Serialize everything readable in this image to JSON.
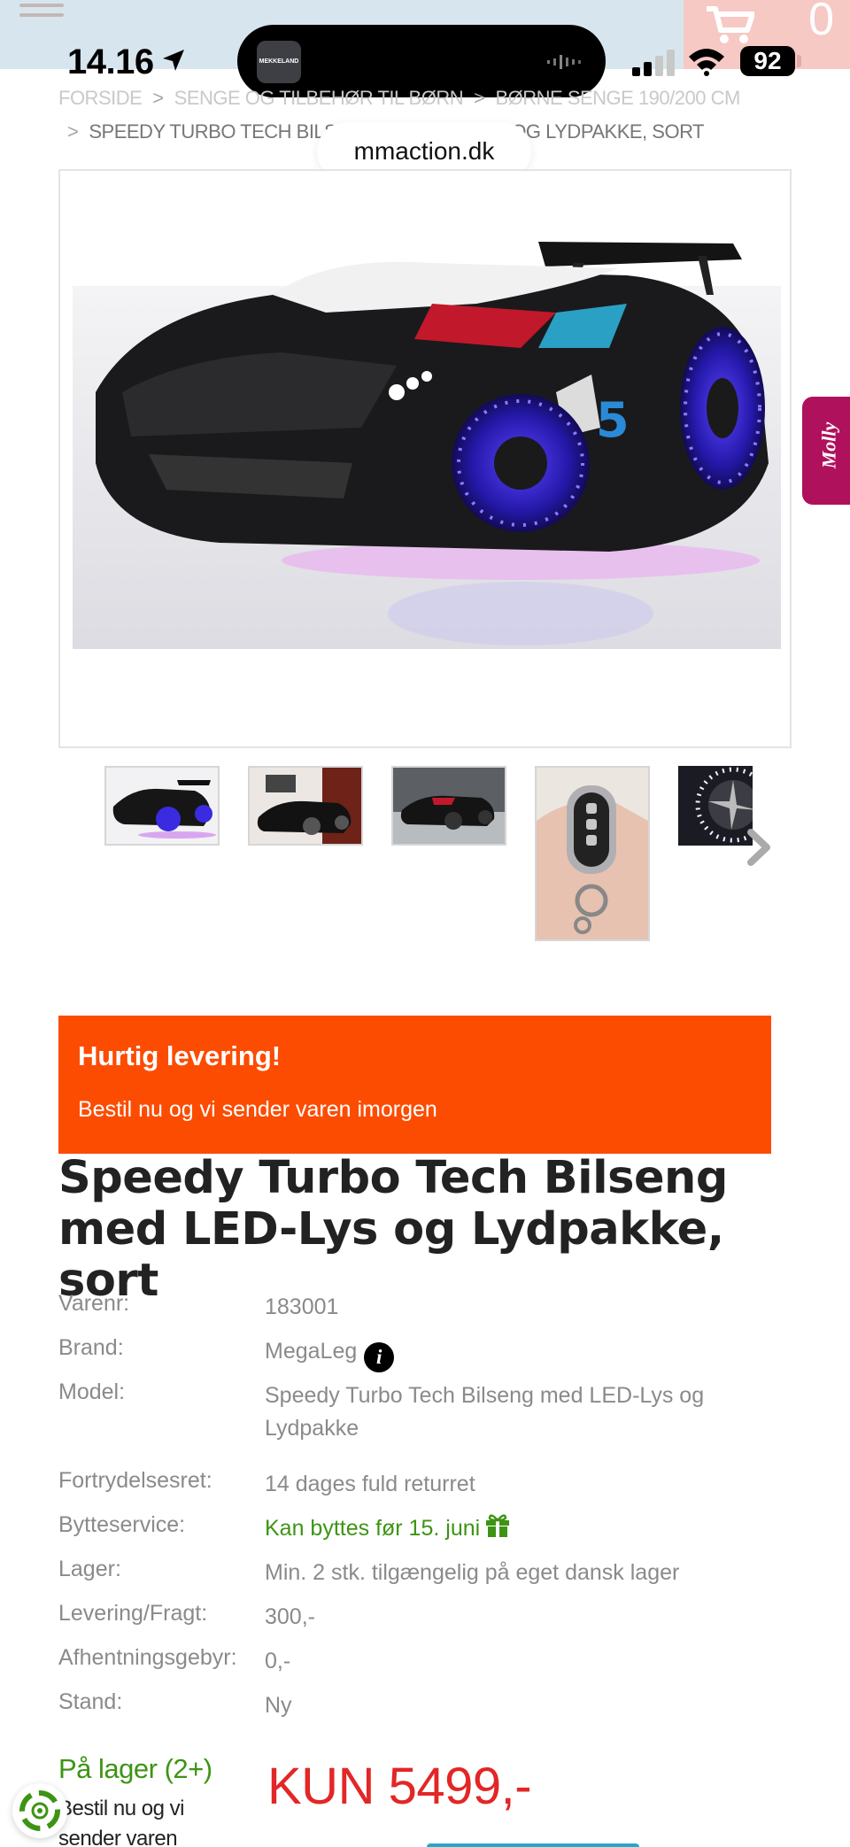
{
  "status_bar": {
    "time": "14.16",
    "battery": "92",
    "island_app_label": "MEKKELAND"
  },
  "header": {
    "cart_count": "0"
  },
  "breadcrumb": {
    "items": [
      "FORSIDE",
      "SENGE OG TILBEHØR TIL BØRN",
      "BØRNE SENGE 190/200 CM"
    ],
    "current": "SPEEDY TURBO TECH BILSENG MED LED-LYS OG LYDPAKKE, SORT"
  },
  "browser": {
    "domain": "mmaction.dk"
  },
  "chat_tab": {
    "label": "Molly"
  },
  "gallery": {
    "main_image_alt": "Black race car bed with LED lights",
    "thumbnails": [
      "car-bed-front",
      "car-bed-room",
      "car-bed-studio",
      "remote-control",
      "led-wheel"
    ]
  },
  "delivery_banner": {
    "title": "Hurtig levering!",
    "subtitle": "Bestil nu og vi sender varen imorgen"
  },
  "product": {
    "title": "Speedy Turbo Tech Bilseng med LED-Lys og Lydpakke, sort"
  },
  "specs": [
    {
      "label": "Varenr:",
      "value": "183001"
    },
    {
      "label": "Brand:",
      "value": "MegaLeg"
    },
    {
      "label": "Model:",
      "value": "Speedy Turbo Tech Bilseng med LED-Lys og Lydpakke"
    },
    {
      "label": "Fortrydelsesret:",
      "value": "14 dages fuld returret"
    },
    {
      "label": "Bytteservice:",
      "value": "Kan byttes før 15. juni"
    },
    {
      "label": "Lager:",
      "value": "Min. 2 stk. tilgængelig på eget dansk lager"
    },
    {
      "label": "Levering/Fragt:",
      "value": "300,-"
    },
    {
      "label": "Afhentningsgebyr:",
      "value": "0,-"
    },
    {
      "label": "Stand:",
      "value": "Ny"
    }
  ],
  "stock": {
    "status": "På lager (2+)",
    "note": "Bestil nu og vi sender varen imorgen"
  },
  "price": {
    "label": "KUN 5499,-"
  },
  "colors": {
    "accent_orange": "#fc4c02",
    "stock_green": "#3d9414",
    "price_red": "#e32626",
    "chat_magenta": "#b0115c"
  }
}
